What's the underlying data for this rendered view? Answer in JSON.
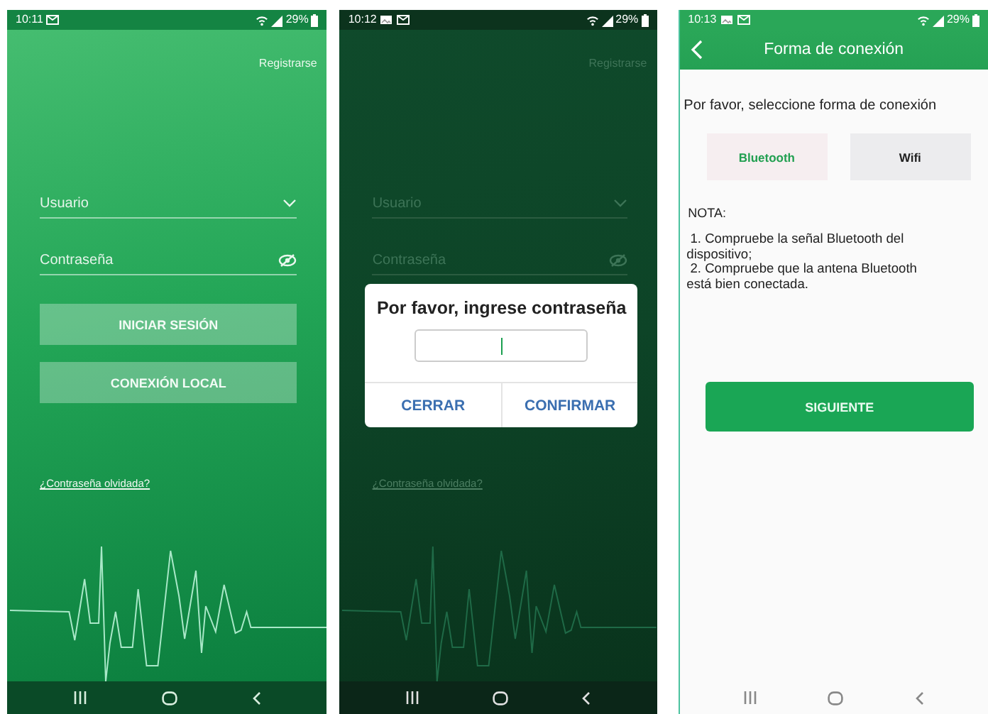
{
  "screens": [
    {
      "kind": "login",
      "dimmed": false,
      "status_bar": {
        "time": "10:11",
        "picture_notification": false,
        "battery": "29%"
      },
      "register_link": "Registrarse",
      "username_field": {
        "placeholder": "Usuario"
      },
      "password_field": {
        "placeholder": "Contraseña"
      },
      "buttons": [
        "INICIAR SESIÓN",
        "CONEXIÓN LOCAL"
      ],
      "forgot_link": "¿Contraseña olvidada?"
    },
    {
      "kind": "login",
      "dimmed": true,
      "status_bar": {
        "time": "10:12",
        "picture_notification": true,
        "battery": "29%"
      },
      "register_link": "Registrarse",
      "username_field": {
        "placeholder": "Usuario"
      },
      "password_field": {
        "placeholder": "Contraseña"
      },
      "forgot_link": "¿Contraseña olvidada?",
      "dialog": {
        "title": "Por favor, ingrese contraseña",
        "buttons": [
          "CERRAR",
          "CONFIRMAR"
        ]
      }
    },
    {
      "kind": "connection",
      "status_bar": {
        "time": "10:13",
        "picture_notification": true,
        "battery": "29%"
      },
      "header": {
        "title": "Forma de conexión"
      },
      "prompt": "Por favor, seleccione forma de conexión",
      "options": [
        {
          "label": "Bluetooth",
          "selected": true
        },
        {
          "label": "Wifi",
          "selected": false
        }
      ],
      "note_title": "NOTA:",
      "note_lines": [
        " 1. Compruebe la señal Bluetooth del dispositivo;",
        " 2. Compruebe que la antena Bluetooth está bien conectada."
      ],
      "button": "SIGUIENTE"
    }
  ]
}
